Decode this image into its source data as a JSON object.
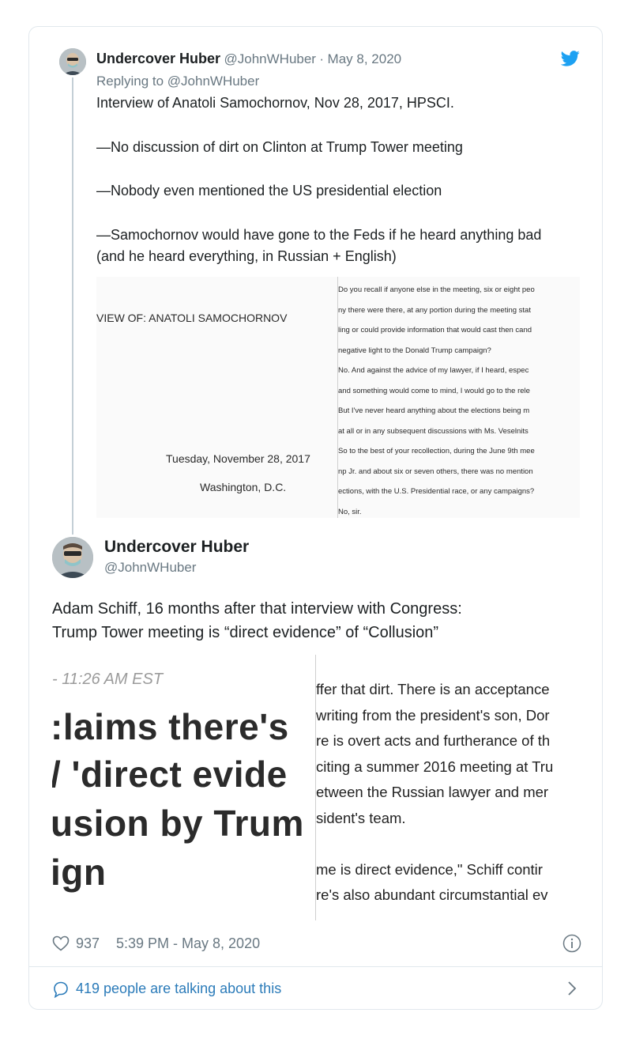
{
  "colors": {
    "link": "#2b7bb9",
    "muted": "#697882",
    "text": "#1c2022",
    "bird": "#1da1f2",
    "thread_line": "#c4cfd6"
  },
  "icons": [
    "twitter-bird-icon",
    "heart-icon",
    "info-icon",
    "comment-bubble-icon",
    "chevron-right-icon"
  ],
  "tweet1": {
    "display_name": "Undercover Huber",
    "handle": "@JohnWHuber",
    "separator": "·",
    "date": "May 8, 2020",
    "replying_to": "Replying to @JohnWHuber",
    "text": [
      "Interview of Anatoli Samochornov, Nov 28, 2017, HPSCI.",
      "—No discussion of dirt on Clinton at Trump Tower meeting",
      "—Nobody even mentioned the US presidential election",
      "—Samochornov would have gone to the Feds if he heard anything bad (and he heard everything, in Russian + English)"
    ],
    "image": {
      "title": "VIEW OF:   ANATOLI SAMOCHORNOV",
      "date": "Tuesday, November 28, 2017",
      "place": "Washington, D.C.",
      "transcript": [
        "Do you recall if anyone else in the meeting, six or eight peo",
        "ny there were there, at any portion during the meeting stat",
        "ling or could provide information that would cast then cand",
        "negative light to the Donald Trump campaign?",
        "No.   And against the advice of my lawyer, if I heard, espec",
        "and something would come to mind, I would go to the rele",
        "But I've never heard anything about the elections being m",
        "at all or in any subsequent discussions with Ms. Veselnits",
        "So to the best of your recollection, during the June 9th mee",
        "np Jr. and about six or seven others, there was no mention",
        "ections, with the U.S. Presidential race, or any campaigns?",
        "No, sir."
      ]
    }
  },
  "tweet2": {
    "display_name": "Undercover Huber",
    "handle": "@JohnWHuber",
    "text": [
      "Adam Schiff, 16 months after that interview with Congress:",
      "Trump Tower meeting is “direct evidence” of “Collusion”"
    ],
    "image": {
      "timestamp": "- 11:26 AM EST",
      "headline": [
        ":laims there's",
        "/ 'direct evide",
        "usion by Trum",
        "ign"
      ],
      "article": [
        "ffer that dirt. There is an acceptance",
        "writing from the president's son, Dor",
        "re is overt acts and furtherance of th",
        "citing a summer 2016 meeting at Tru",
        "etween the Russian lawyer and mer",
        "sident's team.",
        "",
        " me is direct evidence,\" Schiff contir",
        "re's also abundant circumstantial ev"
      ]
    },
    "likes": "937",
    "timestamp": "5:39 PM - May 8, 2020",
    "talking": "419 people are talking about this"
  }
}
